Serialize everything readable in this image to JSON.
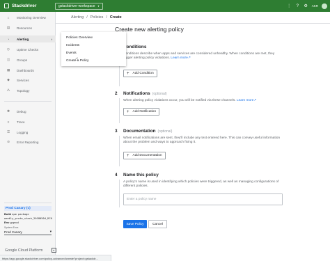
{
  "topbar": {
    "brand": "Stackdriver",
    "workspace": "gstackdriver-workspace",
    "account_initials": "AKR",
    "icons": [
      "apps-icon",
      "help-icon",
      "settings-icon"
    ]
  },
  "sidebar": {
    "items": [
      {
        "label": "Monitoring Overview",
        "icon": "home-icon"
      },
      {
        "label": "Resources",
        "icon": "resources-icon"
      },
      {
        "label": "Alerting",
        "icon": "bell-icon",
        "active": true
      },
      {
        "label": "Uptime Checks",
        "icon": "uptime-icon"
      },
      {
        "label": "Groups",
        "icon": "groups-icon"
      },
      {
        "label": "Dashboards",
        "icon": "dashboard-icon"
      },
      {
        "label": "Services",
        "icon": "services-icon"
      },
      {
        "label": "Topology",
        "icon": "topology-icon"
      },
      {
        "label": "Debug",
        "icon": "debug-icon"
      },
      {
        "label": "Trace",
        "icon": "trace-icon"
      },
      {
        "label": "Logging",
        "icon": "logging-icon"
      },
      {
        "label": "Error Reporting",
        "icon": "error-icon"
      }
    ],
    "canary": {
      "title": "Prod Canary (c)",
      "build_label": "Build",
      "build_value": "npm package weekly_proto_stack_20180504_RC0",
      "env_label": "Env",
      "env_value": "gcprod",
      "select_label": "System Envs",
      "select_value": "Prod Canary"
    },
    "footer": "Google Cloud Platform"
  },
  "breadcrumb": {
    "items": [
      "Alerting",
      "Policies"
    ],
    "current": "Create"
  },
  "flyout": {
    "items": [
      "Policies Overview",
      "Incidents",
      "Events",
      "Create a Policy"
    ]
  },
  "main": {
    "title": "Create new alerting policy",
    "steps": [
      {
        "num": "1",
        "title": "Conditions",
        "desc": "Conditions describe when apps and services are considered unhealthy. When conditions are met, they trigger alerting policy violations.",
        "link": "Learn more",
        "button": "Add Condition"
      },
      {
        "num": "2",
        "title": "Notifications",
        "optional": "(optional)",
        "desc": "When alerting policy violations occur, you will be notified via these channels.",
        "link": "Learn more",
        "button": "Add Notification"
      },
      {
        "num": "3",
        "title": "Documentation",
        "optional": "(optional)",
        "desc": "When email notifications are sent, they'll include any text entered here. This can convey useful information about the problem and ways to approach fixing it.",
        "button": "Add Documentation"
      },
      {
        "num": "4",
        "title": "Name this policy",
        "desc": "A policy's name is used in identifying which policies were triggered, as well as managing configurations of different policies.",
        "placeholder": "Enter a policy name"
      }
    ],
    "save": "Save Policy",
    "cancel": "Cancel"
  },
  "statusbar": "https://app.google.stackdriver.com/policy-advanced/create?project=gstackdr...",
  "colors": {
    "topbar": "#2e7d32",
    "primary": "#1a73e8",
    "link": "#1a73e8"
  }
}
